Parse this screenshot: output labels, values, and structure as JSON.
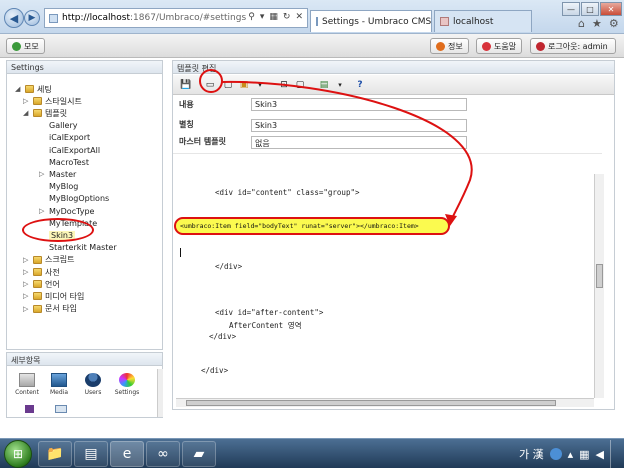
{
  "browser": {
    "url_host": "http://localhost",
    "url_rest": ":1867/Umbraco/#settings",
    "tabs": [
      {
        "label": "Settings - Umbraco CMS - ..."
      },
      {
        "label": "localhost"
      }
    ]
  },
  "header": {
    "left_button": "모모",
    "help": "정보",
    "help2": "도움말",
    "logout": "로그아웃: admin"
  },
  "tree": {
    "title": "Settings",
    "items": [
      {
        "label": "세팅",
        "level": 0
      },
      {
        "label": "스타일시트",
        "level": 1
      },
      {
        "label": "템플릿",
        "level": 1
      },
      {
        "label": "Gallery",
        "level": 2
      },
      {
        "label": "iCalExport",
        "level": 2
      },
      {
        "label": "iCalExportAll",
        "level": 2
      },
      {
        "label": "MacroTest",
        "level": 2
      },
      {
        "label": "Master",
        "level": 2
      },
      {
        "label": "MyBlog",
        "level": 2
      },
      {
        "label": "MyBlogOptions",
        "level": 2
      },
      {
        "label": "MyDocType",
        "level": 2
      },
      {
        "label": "MyTemplate",
        "level": 2
      },
      {
        "label": "Skin3",
        "level": 2
      },
      {
        "label": "Starterkit Master",
        "level": 2
      },
      {
        "label": "스크립트",
        "level": 1
      },
      {
        "label": "사전",
        "level": 1
      },
      {
        "label": "언어",
        "level": 1
      },
      {
        "label": "미디어 타입",
        "level": 1
      },
      {
        "label": "문서 타입",
        "level": 1
      }
    ]
  },
  "detail": {
    "title": "세부항목",
    "icons": [
      {
        "label": "Content"
      },
      {
        "label": "Media"
      },
      {
        "label": "Users"
      },
      {
        "label": "Settings"
      }
    ]
  },
  "editor": {
    "title": "템플릿 편집",
    "fields": {
      "name_label": "내용",
      "name_value": "Skin3",
      "alias_label": "별칭",
      "alias_value": "Skin3",
      "master_label": "마스터 템플릿",
      "master_value": "없음"
    },
    "code": {
      "line1": "<div id=\"content\" class=\"group\">",
      "highlight": "<umbraco:Item field=\"bodyText\" runat=\"server\"></umbraco:Item>",
      "line3": "</div>",
      "line4": "<div id=\"after-content\">",
      "line5": "AfterContent 영역",
      "line6": "</div>",
      "line7": "</div>"
    }
  },
  "taskbar": {
    "ime": "가 漢"
  },
  "colors": {
    "annotation_red": "#dd1111",
    "highlight_yellow": "#fbfa4f"
  }
}
